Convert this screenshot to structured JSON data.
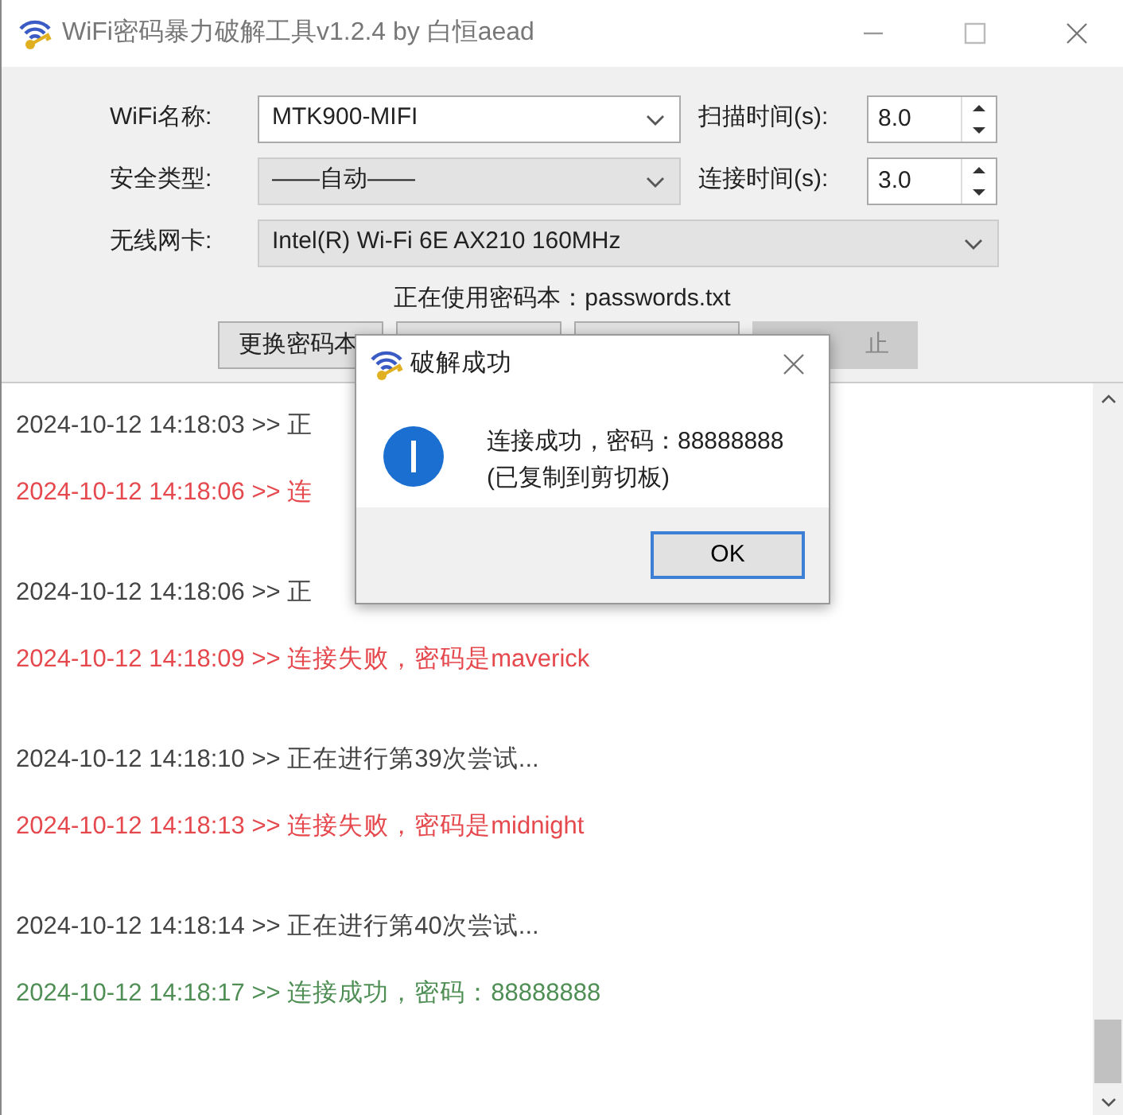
{
  "window": {
    "title": "WiFi密码暴力破解工具v1.2.4 by 白恒aead"
  },
  "form": {
    "wifi_name": {
      "label": "WiFi名称:",
      "value": "MTK900-MIFI",
      "disabled": false
    },
    "scan_time": {
      "label": "扫描时间(s):",
      "value": "8.0"
    },
    "security": {
      "label": "安全类型:",
      "value": "——自动——",
      "disabled": true
    },
    "connect_time": {
      "label": "连接时间(s):",
      "value": "3.0"
    },
    "adapter": {
      "label": "无线网卡:",
      "value": "Intel(R) Wi-Fi 6E AX210 160MHz",
      "disabled": true
    },
    "password_file": "正在使用密码本：passwords.txt"
  },
  "buttons": [
    {
      "label": "更换密码本",
      "disabled": false
    },
    {
      "disabled": false
    },
    {
      "disabled": false
    },
    {
      "label": "止",
      "disabled": true
    }
  ],
  "log": [
    {
      "kind": "info",
      "text": "2024-10-12 14:18:03 >> 正"
    },
    {
      "kind": "fail",
      "text": "2024-10-12 14:18:06 >> 连"
    },
    {
      "kind": "info",
      "text": "2024-10-12 14:18:06 >> 正"
    },
    {
      "kind": "fail",
      "text": "2024-10-12 14:18:09 >> 连接失败，密码是maverick"
    },
    {
      "kind": "info",
      "text": "2024-10-12 14:18:10 >> 正在进行第39次尝试..."
    },
    {
      "kind": "fail",
      "text": "2024-10-12 14:18:13 >> 连接失败，密码是midnight"
    },
    {
      "kind": "info",
      "text": "2024-10-12 14:18:14 >> 正在进行第40次尝试..."
    },
    {
      "kind": "success",
      "text": "2024-10-12 14:18:17 >> 连接成功，密码：88888888"
    }
  ],
  "dialog": {
    "title": "破解成功",
    "message": "连接成功，密码：88888888",
    "note": "(已复制到剪切板)",
    "ok": "OK"
  }
}
